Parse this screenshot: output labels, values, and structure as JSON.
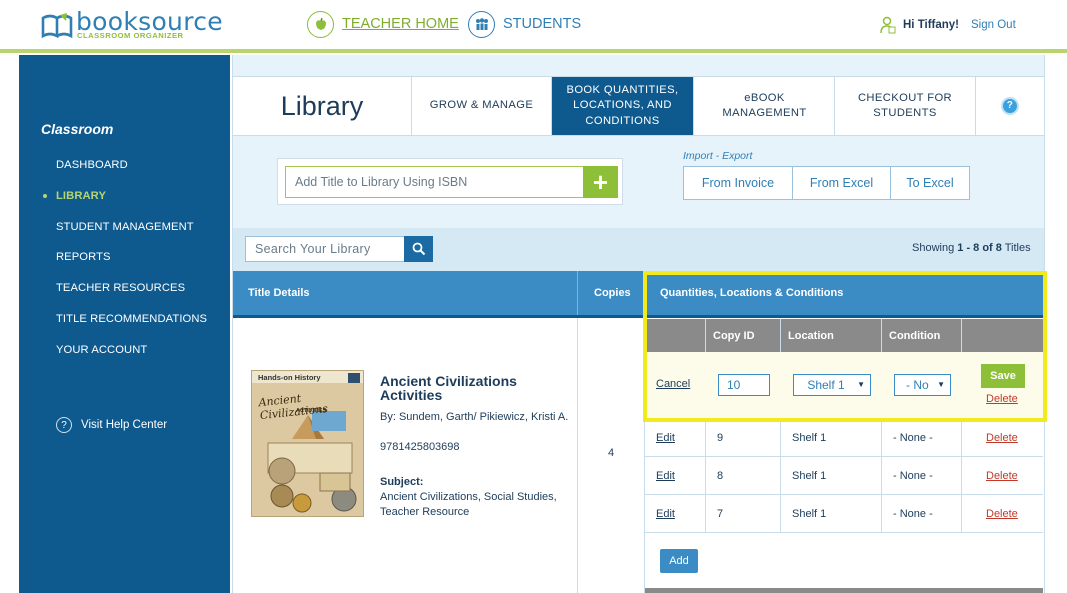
{
  "header": {
    "logo_main": "booksource",
    "logo_sub": "CLASSROOM ORGANIZER",
    "nav": [
      {
        "label": "TEACHER HOME",
        "icon": "apple-icon"
      },
      {
        "label": "STUDENTS",
        "icon": "students-icon"
      }
    ],
    "greeting": "Hi Tiffany!",
    "signout": "Sign Out"
  },
  "sidebar": {
    "title": "Classroom",
    "items": [
      {
        "label": "DASHBOARD",
        "active": false
      },
      {
        "label": "LIBRARY",
        "active": true
      },
      {
        "label": "STUDENT MANAGEMENT",
        "active": false
      },
      {
        "label": "REPORTS",
        "active": false
      },
      {
        "label": "TEACHER RESOURCES",
        "active": false
      },
      {
        "label": "TITLE RECOMMENDATIONS",
        "active": false
      },
      {
        "label": "YOUR ACCOUNT",
        "active": false
      }
    ],
    "help": "Visit Help Center"
  },
  "tabs": {
    "page_title": "Library",
    "items": [
      {
        "label": "GROW & MANAGE"
      },
      {
        "label": "BOOK QUANTITIES, LOCATIONS, AND CONDITIONS",
        "active": true
      },
      {
        "label": "eBOOK MANAGEMENT"
      },
      {
        "label": "CHECKOUT FOR STUDENTS"
      }
    ],
    "help_icon": "?"
  },
  "isbn": {
    "placeholder": "Add Title to Library Using ISBN",
    "add_icon": "+"
  },
  "import_export": {
    "label": "Import - Export",
    "buttons": [
      "From Invoice",
      "From Excel",
      "To Excel"
    ]
  },
  "search": {
    "placeholder": "Search Your Library",
    "showing_prefix": "Showing ",
    "showing_range": "1 - 8 of 8",
    "showing_suffix": " Titles"
  },
  "table": {
    "headers": [
      "Title Details",
      "Copies",
      "Quantities, Locations & Conditions"
    ],
    "book": {
      "title": "Ancient Civilizations Activities",
      "authors": "By: Sundem, Garth/ Pikiewicz, Kristi A.",
      "isbn": "9781425803698",
      "subject_label": "Subject:",
      "subjects": "Ancient Civilizations, Social Studies, Teacher Resource",
      "cover_series": "Hands-on History",
      "cover_title": "Ancient Civilizations",
      "cover_sub": "ACTIVITIES",
      "copies": "4"
    },
    "sub_headers": [
      "Copy ID",
      "Location",
      "Condition"
    ],
    "edit_row": {
      "cancel": "Cancel",
      "copy_id": "10",
      "location": "Shelf 1",
      "condition": "- No",
      "save": "Save",
      "delete": "Delete"
    },
    "rows": [
      {
        "action": "Edit",
        "copy_id": "9",
        "location": "Shelf 1",
        "condition": "- None -",
        "delete": "Delete"
      },
      {
        "action": "Edit",
        "copy_id": "8",
        "location": "Shelf 1",
        "condition": "- None -",
        "delete": "Delete"
      },
      {
        "action": "Edit",
        "copy_id": "7",
        "location": "Shelf 1",
        "condition": "- None -",
        "delete": "Delete"
      }
    ],
    "add": "Add"
  },
  "colors": {
    "brand_blue": "#0e5a8f",
    "accent_green": "#8ebf38",
    "highlight_yellow": "#f2ea1c",
    "delete_red": "#c0392b"
  }
}
